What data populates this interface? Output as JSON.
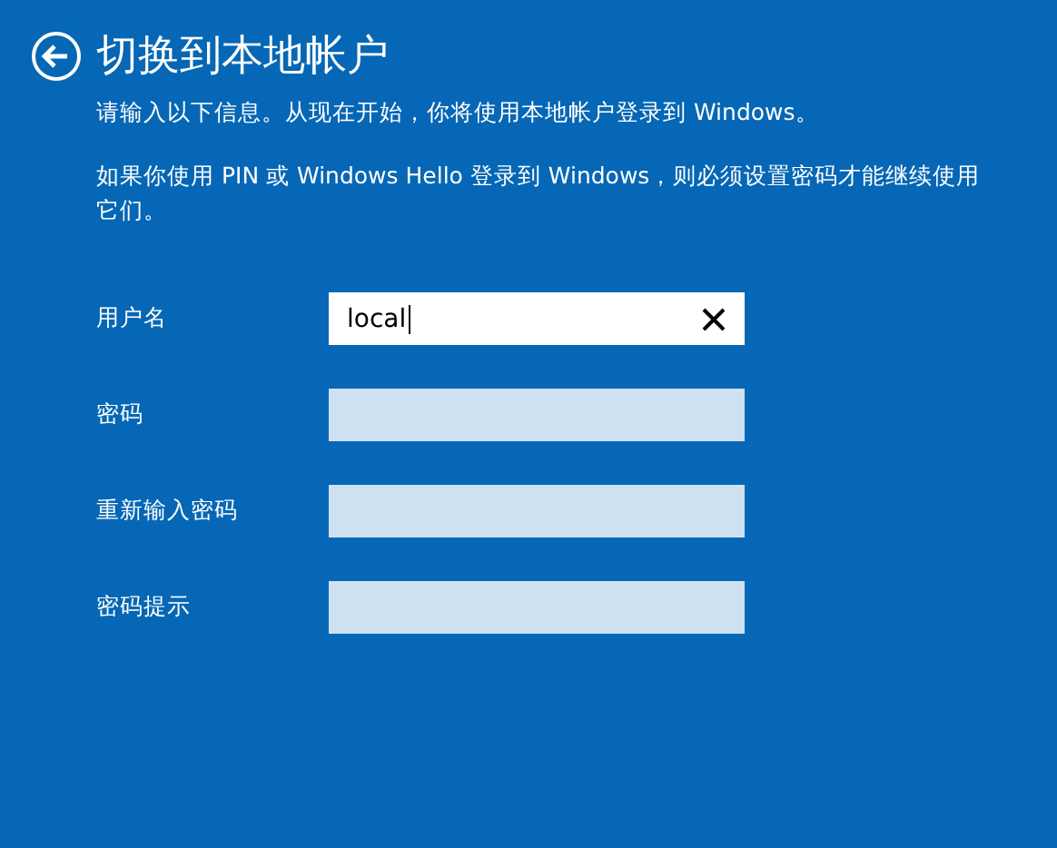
{
  "title": "切换到本地帐户",
  "intro": "请输入以下信息。从现在开始，你将使用本地帐户登录到 Windows。",
  "note": "如果你使用 PIN 或 Windows Hello 登录到 Windows，则必须设置密码才能继续使用它们。",
  "fields": [
    {
      "label": "用户名",
      "value": "local",
      "focused": true
    },
    {
      "label": "密码",
      "focused": false
    },
    {
      "label": "重新输入密码",
      "focused": false
    },
    {
      "label": "密码提示",
      "focused": false
    }
  ]
}
